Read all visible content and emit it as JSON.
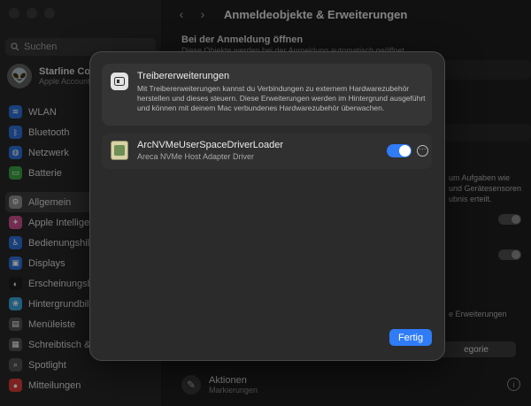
{
  "sidebar": {
    "search_placeholder": "Suchen",
    "account": {
      "name": "Starline Co",
      "subtitle": "Apple Account"
    },
    "items": [
      {
        "label": "WLAN",
        "icon": "wifi-icon",
        "color": "#2d6fd6"
      },
      {
        "label": "Bluetooth",
        "icon": "bluetooth-icon",
        "color": "#2d6fd6"
      },
      {
        "label": "Netzwerk",
        "icon": "network-icon",
        "color": "#2d6fd6"
      },
      {
        "label": "Batterie",
        "icon": "battery-icon",
        "color": "#3aa143"
      },
      {
        "label": "Allgemein",
        "icon": "gear-icon",
        "color": "#8e8e93"
      },
      {
        "label": "Apple Intelligen",
        "icon": "apple-intelligence-icon",
        "color": "#c94f8c"
      },
      {
        "label": "Bedienungshilfe",
        "icon": "accessibility-icon",
        "color": "#2d6fd6"
      },
      {
        "label": "Displays",
        "icon": "display-icon",
        "color": "#2d6fd6"
      },
      {
        "label": "Erscheinungsbil",
        "icon": "appearance-icon",
        "color": "#1c1c1c"
      },
      {
        "label": "Hintergrundbild",
        "icon": "wallpaper-icon",
        "color": "#3aa0d6"
      },
      {
        "label": "Menüleiste",
        "icon": "menubar-icon",
        "color": "#505050"
      },
      {
        "label": "Schreibtisch & D",
        "icon": "desktop-icon",
        "color": "#505050"
      },
      {
        "label": "Spotlight",
        "icon": "spotlight-icon",
        "color": "#505050"
      },
      {
        "label": "Mitteilungen",
        "icon": "notifications-icon",
        "color": "#d83a3a"
      }
    ]
  },
  "main": {
    "title": "Anmeldeobjekte & Erweiterungen",
    "heading": "Bei der Anmeldung öffnen",
    "subheading": "Diese Objekte werden bei der Anmeldung automatisch geöffnet.",
    "right_text_1a": "um Aufgaben wie",
    "right_text_1b": "und Gerätesensoren",
    "right_text_1c": "ubnis erteilt.",
    "right_text_2": "e Erweiterungen",
    "category_button": "egorie",
    "actions_name": "Aktionen",
    "actions_sub": "Markierungen"
  },
  "modal": {
    "info_title": "Treibererweiterungen",
    "info_desc": "Mit Treibererweiterungen kannst du Verbindungen zu externem Hardwarezubehör herstellen und dieses steuern. Diese Erweiterungen werden im Hintergrund ausgeführt und können mit deinem Mac verbundenes Hardwarezubehör überwachen.",
    "driver_name": "ArcNVMeUserSpaceDriverLoader",
    "driver_sub": "Areca NVMe Host Adapter Driver",
    "driver_enabled": true,
    "done_label": "Fertig"
  },
  "colors": {
    "accent": "#2f7cf6"
  }
}
